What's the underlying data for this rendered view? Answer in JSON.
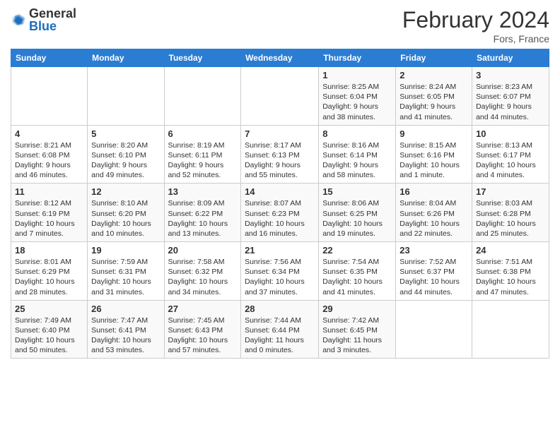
{
  "header": {
    "logo_general": "General",
    "logo_blue": "Blue",
    "month_title": "February 2024",
    "subtitle": "Fors, France"
  },
  "weekdays": [
    "Sunday",
    "Monday",
    "Tuesday",
    "Wednesday",
    "Thursday",
    "Friday",
    "Saturday"
  ],
  "weeks": [
    [
      {
        "day": "",
        "info": ""
      },
      {
        "day": "",
        "info": ""
      },
      {
        "day": "",
        "info": ""
      },
      {
        "day": "",
        "info": ""
      },
      {
        "day": "1",
        "info": "Sunrise: 8:25 AM\nSunset: 6:04 PM\nDaylight: 9 hours and 38 minutes."
      },
      {
        "day": "2",
        "info": "Sunrise: 8:24 AM\nSunset: 6:05 PM\nDaylight: 9 hours and 41 minutes."
      },
      {
        "day": "3",
        "info": "Sunrise: 8:23 AM\nSunset: 6:07 PM\nDaylight: 9 hours and 44 minutes."
      }
    ],
    [
      {
        "day": "4",
        "info": "Sunrise: 8:21 AM\nSunset: 6:08 PM\nDaylight: 9 hours and 46 minutes."
      },
      {
        "day": "5",
        "info": "Sunrise: 8:20 AM\nSunset: 6:10 PM\nDaylight: 9 hours and 49 minutes."
      },
      {
        "day": "6",
        "info": "Sunrise: 8:19 AM\nSunset: 6:11 PM\nDaylight: 9 hours and 52 minutes."
      },
      {
        "day": "7",
        "info": "Sunrise: 8:17 AM\nSunset: 6:13 PM\nDaylight: 9 hours and 55 minutes."
      },
      {
        "day": "8",
        "info": "Sunrise: 8:16 AM\nSunset: 6:14 PM\nDaylight: 9 hours and 58 minutes."
      },
      {
        "day": "9",
        "info": "Sunrise: 8:15 AM\nSunset: 6:16 PM\nDaylight: 10 hours and 1 minute."
      },
      {
        "day": "10",
        "info": "Sunrise: 8:13 AM\nSunset: 6:17 PM\nDaylight: 10 hours and 4 minutes."
      }
    ],
    [
      {
        "day": "11",
        "info": "Sunrise: 8:12 AM\nSunset: 6:19 PM\nDaylight: 10 hours and 7 minutes."
      },
      {
        "day": "12",
        "info": "Sunrise: 8:10 AM\nSunset: 6:20 PM\nDaylight: 10 hours and 10 minutes."
      },
      {
        "day": "13",
        "info": "Sunrise: 8:09 AM\nSunset: 6:22 PM\nDaylight: 10 hours and 13 minutes."
      },
      {
        "day": "14",
        "info": "Sunrise: 8:07 AM\nSunset: 6:23 PM\nDaylight: 10 hours and 16 minutes."
      },
      {
        "day": "15",
        "info": "Sunrise: 8:06 AM\nSunset: 6:25 PM\nDaylight: 10 hours and 19 minutes."
      },
      {
        "day": "16",
        "info": "Sunrise: 8:04 AM\nSunset: 6:26 PM\nDaylight: 10 hours and 22 minutes."
      },
      {
        "day": "17",
        "info": "Sunrise: 8:03 AM\nSunset: 6:28 PM\nDaylight: 10 hours and 25 minutes."
      }
    ],
    [
      {
        "day": "18",
        "info": "Sunrise: 8:01 AM\nSunset: 6:29 PM\nDaylight: 10 hours and 28 minutes."
      },
      {
        "day": "19",
        "info": "Sunrise: 7:59 AM\nSunset: 6:31 PM\nDaylight: 10 hours and 31 minutes."
      },
      {
        "day": "20",
        "info": "Sunrise: 7:58 AM\nSunset: 6:32 PM\nDaylight: 10 hours and 34 minutes."
      },
      {
        "day": "21",
        "info": "Sunrise: 7:56 AM\nSunset: 6:34 PM\nDaylight: 10 hours and 37 minutes."
      },
      {
        "day": "22",
        "info": "Sunrise: 7:54 AM\nSunset: 6:35 PM\nDaylight: 10 hours and 41 minutes."
      },
      {
        "day": "23",
        "info": "Sunrise: 7:52 AM\nSunset: 6:37 PM\nDaylight: 10 hours and 44 minutes."
      },
      {
        "day": "24",
        "info": "Sunrise: 7:51 AM\nSunset: 6:38 PM\nDaylight: 10 hours and 47 minutes."
      }
    ],
    [
      {
        "day": "25",
        "info": "Sunrise: 7:49 AM\nSunset: 6:40 PM\nDaylight: 10 hours and 50 minutes."
      },
      {
        "day": "26",
        "info": "Sunrise: 7:47 AM\nSunset: 6:41 PM\nDaylight: 10 hours and 53 minutes."
      },
      {
        "day": "27",
        "info": "Sunrise: 7:45 AM\nSunset: 6:43 PM\nDaylight: 10 hours and 57 minutes."
      },
      {
        "day": "28",
        "info": "Sunrise: 7:44 AM\nSunset: 6:44 PM\nDaylight: 11 hours and 0 minutes."
      },
      {
        "day": "29",
        "info": "Sunrise: 7:42 AM\nSunset: 6:45 PM\nDaylight: 11 hours and 3 minutes."
      },
      {
        "day": "",
        "info": ""
      },
      {
        "day": "",
        "info": ""
      }
    ]
  ]
}
